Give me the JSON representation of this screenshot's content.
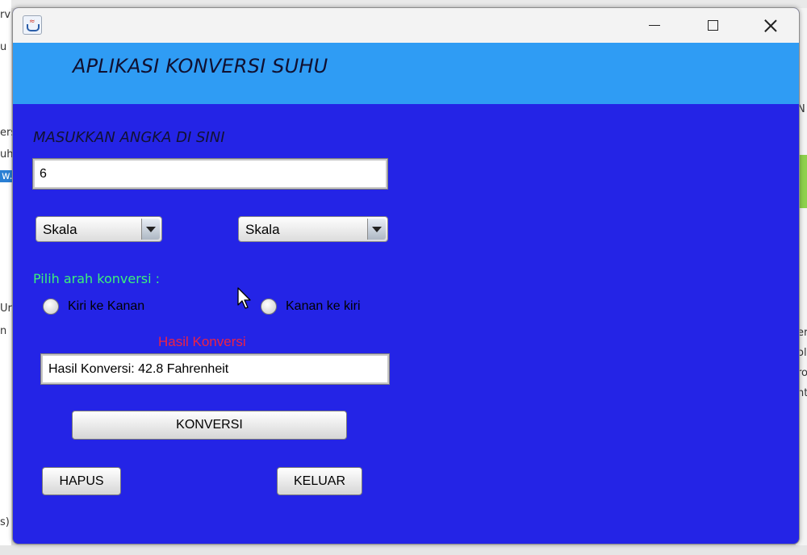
{
  "window": {
    "title_bar_icon": "java-icon",
    "controls": [
      "minimize-icon",
      "maximize-icon",
      "close-icon"
    ]
  },
  "header": {
    "title": "APLIKASI KONVERSI SUHU"
  },
  "form": {
    "input_label": "MASUKKAN ANGKA DI SINI",
    "input_value": "6",
    "combo_from": "Skala",
    "combo_to": "Skala",
    "direction_label": "Pilih arah konversi :",
    "radio_left": "Kiri ke Kanan",
    "radio_right": "Kanan ke kiri",
    "result_label": "Hasil Konversi",
    "result_value": "Hasil Konversi: 42.8 Fahrenheit"
  },
  "buttons": {
    "convert": "KONVERSI",
    "clear": "HAPUS",
    "exit": "KELUAR"
  },
  "background": {
    "left_fragments": [
      "rv",
      "u",
      "ers",
      "uh",
      "w.",
      "Ur",
      "n",
      "s)"
    ],
    "right_fragments": [
      "N",
      "er",
      "ol",
      "ro",
      "nt"
    ]
  },
  "colors": {
    "window_bg": "#2424e6",
    "header_bg": "#2f9cf4",
    "direction_label": "#3cf07a",
    "result_label": "#ee2244"
  }
}
